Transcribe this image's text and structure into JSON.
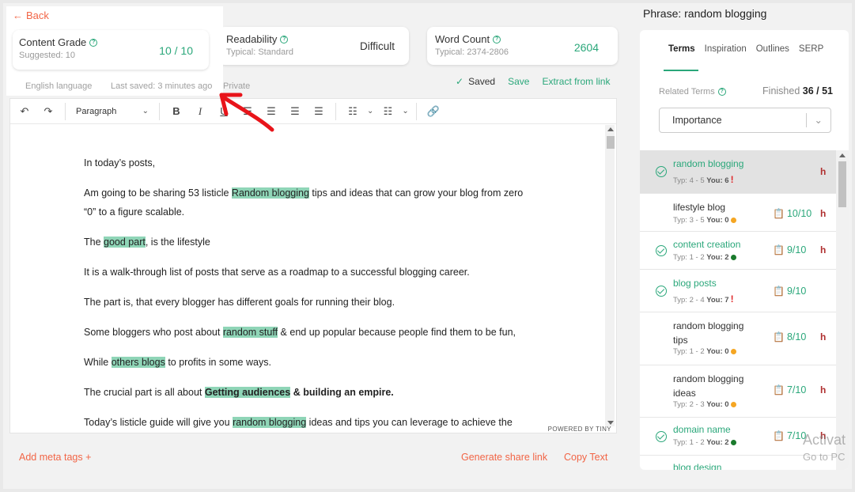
{
  "header": {
    "back_label": "Back",
    "content_grade": {
      "title": "Content Grade",
      "suggested": "Suggested: 10",
      "value": "10 / 10"
    },
    "readability": {
      "title": "Readability",
      "typical": "Typical: Standard",
      "value": "Difficult"
    },
    "word_count": {
      "title": "Word Count",
      "typical": "Typical: 2374-2806",
      "value": "2604"
    },
    "language": "English language",
    "last_saved": "Last saved: 3 minutes ago",
    "private": "Private",
    "saved_status": "Saved",
    "save_label": "Save",
    "extract_label": "Extract from link"
  },
  "toolbar": {
    "block_format": "Paragraph"
  },
  "editor": {
    "p1": "In today’s posts,",
    "p2a": "Am going to be sharing 53 listicle ",
    "p2m": "Random blogging",
    "p2b": " tips and ideas that can grow your blog from zero",
    "p2c": "“0” to a figure scalable.",
    "p3a": "The ",
    "p3m": "good part",
    "p3b": ", is the lifestyle",
    "p4": "It is a walk-through list of posts that serve as a roadmap to a successful blogging career.",
    "p5": "The part is, that every blogger has different goals for running their blog.",
    "p6a": "Some bloggers who post about ",
    "p6m": "random stuff",
    "p6b": " & end up popular because people find them to be fun,",
    "p7a": "While ",
    "p7m": "others blogs",
    "p7b": " to profits in some ways.",
    "p8a": "The crucial part is all about ",
    "p8m": "Getting audiences",
    "p8b": " & building an empire.",
    "p9a": "Today’s listicle guide will give you ",
    "p9m": "random blogging",
    "p9b": " ideas and tips you can leverage to achieve the",
    "powered": "POWERED BY TINY"
  },
  "footer": {
    "meta_tags": "Add meta tags +",
    "share_link": "Generate share link",
    "copy_text": "Copy Text"
  },
  "panel": {
    "phrase": "Phrase: random blogging",
    "tabs": [
      "Terms",
      "Inspiration",
      "Outlines",
      "SERP"
    ],
    "related_terms": "Related Terms",
    "finished_label": "Finished",
    "finished_value": "36 / 51",
    "sort": "Importance",
    "terms": [
      {
        "name": "random blogging",
        "typ": "Typ: 4 - 5",
        "you": "You: 6",
        "count": "",
        "h": "h"
      },
      {
        "name": "lifestyle blog",
        "typ": "Typ: 3 - 5",
        "you": "You: 0",
        "count": "10/10",
        "h": "h"
      },
      {
        "name": "content creation",
        "typ": "Typ: 1 - 2",
        "you": "You: 2",
        "count": "9/10",
        "h": "h"
      },
      {
        "name": "blog posts",
        "typ": "Typ: 2 - 4",
        "you": "You: 7",
        "count": "9/10",
        "h": ""
      },
      {
        "name_l1": "random blogging",
        "name_l2": "tips",
        "typ": "Typ: 1 - 2",
        "you": "You: 0",
        "count": "8/10",
        "h": "h"
      },
      {
        "name_l1": "random blogging",
        "name_l2": "ideas",
        "typ": "Typ: 2 - 3",
        "you": "You: 0",
        "count": "7/10",
        "h": "h"
      },
      {
        "name": "domain name",
        "typ": "Typ: 1 - 2",
        "you": "You: 2",
        "count": "7/10",
        "h": "h"
      },
      {
        "name": "blog design"
      }
    ]
  },
  "watermark": {
    "line1": "Activat",
    "line2": "Go to PC"
  },
  "colors": {
    "accent": "#2aa77a",
    "orange": "#f26546",
    "highlight": "#8fd5b7",
    "arrow": "#e8141a"
  }
}
